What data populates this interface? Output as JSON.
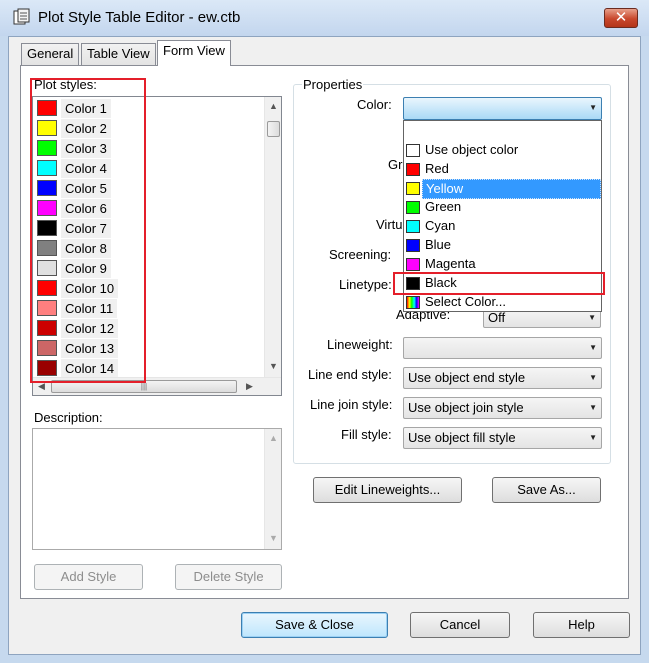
{
  "window": {
    "title": "Plot Style Table Editor - ew.ctb",
    "close_glyph": "✕"
  },
  "tabs": [
    {
      "label": "General",
      "active": false
    },
    {
      "label": "Table View",
      "active": false
    },
    {
      "label": "Form View",
      "active": true
    }
  ],
  "plot_styles": {
    "label": "Plot styles:",
    "items": [
      {
        "name": "Color 1",
        "color": "#ff0000"
      },
      {
        "name": "Color 2",
        "color": "#ffff00"
      },
      {
        "name": "Color 3",
        "color": "#00ff00"
      },
      {
        "name": "Color 4",
        "color": "#00ffff"
      },
      {
        "name": "Color 5",
        "color": "#0000ff"
      },
      {
        "name": "Color 6",
        "color": "#ff00ff"
      },
      {
        "name": "Color 7",
        "color": "#000000"
      },
      {
        "name": "Color 8",
        "color": "#808080"
      },
      {
        "name": "Color 9",
        "color": "#e0e0e0"
      },
      {
        "name": "Color 10",
        "color": "#ff0000"
      },
      {
        "name": "Color 11",
        "color": "#ff7f7f"
      },
      {
        "name": "Color 12",
        "color": "#cc0000"
      },
      {
        "name": "Color 13",
        "color": "#cc6666"
      },
      {
        "name": "Color 14",
        "color": "#990000"
      }
    ],
    "hscroll_thumb_glyph": "|||"
  },
  "description": {
    "label": "Description:"
  },
  "buttons": {
    "add_style": "Add Style",
    "delete_style": "Delete Style",
    "edit_lineweights": "Edit Lineweights...",
    "save_as": "Save As...",
    "save_close": "Save & Close",
    "cancel": "Cancel",
    "help": "Help"
  },
  "properties": {
    "group_label": "Properties",
    "color_label": "Color:",
    "grayscale_label_partial": "Gr",
    "virtual_pen_label_partial": "Virtu",
    "screening_label": "Screening:",
    "linetype_label": "Linetype:",
    "adaptive_label_partial": "Adaptive:",
    "adaptive_value": "Off",
    "lineweight_label": "Lineweight:",
    "lineweight_value": "",
    "line_end_label": "Line end style:",
    "line_end_value": "Use object end style",
    "line_join_label": "Line join style:",
    "line_join_value": "Use object join style",
    "fill_label": "Fill style:",
    "fill_value": "Use object fill style"
  },
  "color_dropdown": {
    "options": [
      {
        "label": "Use object color",
        "swatch": "#ffffff",
        "selected": false
      },
      {
        "label": "Red",
        "swatch": "#ff0000",
        "selected": false
      },
      {
        "label": "Yellow",
        "swatch": "#ffff00",
        "selected": true
      },
      {
        "label": "Green",
        "swatch": "#00ff00",
        "selected": false
      },
      {
        "label": "Cyan",
        "swatch": "#00ffff",
        "selected": false
      },
      {
        "label": "Blue",
        "swatch": "#0000ff",
        "selected": false
      },
      {
        "label": "Magenta",
        "swatch": "#ff00ff",
        "selected": false
      },
      {
        "label": "Black",
        "swatch": "#000000",
        "selected": false
      },
      {
        "label": "Select Color...",
        "swatch": "multicolor",
        "selected": false
      }
    ]
  },
  "colors": {
    "highlight_outline": "#e41f2a",
    "selection": "#3399ff"
  }
}
